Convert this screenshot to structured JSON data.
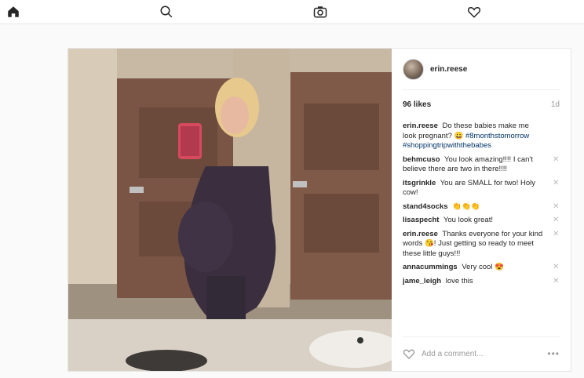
{
  "nav": {
    "home_icon": "home-icon",
    "search_icon": "search-icon",
    "camera_icon": "camera-icon",
    "activity_icon": "heart-icon"
  },
  "post": {
    "username": "erin.reese",
    "likes": "96 likes",
    "age": "1d",
    "caption": {
      "user": "erin.reese",
      "text": "Do these babies make me look pregnant? 😀",
      "tags": "#8monthstomorrow #shoppingtripwiththebabes"
    },
    "comments": [
      {
        "user": "behmcuso",
        "text": "You look amazing!!!! I can't believe there are two in there!!!!",
        "delete": "✕"
      },
      {
        "user": "itsgrinkle",
        "text": "You are SMALL for two! Holy cow!",
        "delete": "✕"
      },
      {
        "user": "stand4socks",
        "text": "👏👏👏",
        "delete": "✕"
      },
      {
        "user": "lisaspecht",
        "text": "You look great!",
        "delete": "✕"
      },
      {
        "user": "erin.reese",
        "text": "Thanks everyone for your kind words 😘! Just getting so ready to meet these little guys!!!",
        "delete": "✕"
      },
      {
        "user": "annacummings",
        "text": "Very cool 😍",
        "delete": "✕"
      },
      {
        "user": "jame_leigh",
        "text": "love this",
        "delete": "✕"
      }
    ],
    "add_comment_placeholder": "Add a comment...",
    "more_label": "•••"
  },
  "colors": {
    "link": "#003569",
    "border": "#e6e6e6",
    "muted": "#999999"
  }
}
